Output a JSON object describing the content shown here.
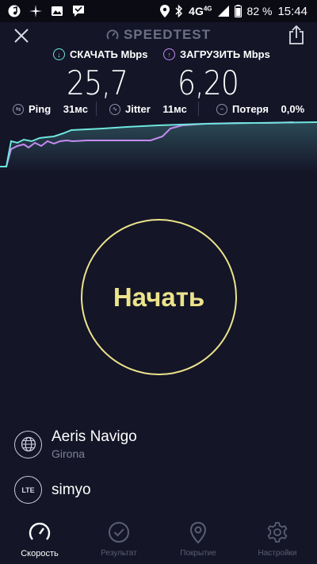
{
  "status_bar": {
    "network": "4G",
    "network_sup": "4G",
    "battery": "82 %",
    "time": "15:44",
    "left_icons": [
      "music-app-icon",
      "sparkle-app-icon",
      "gallery-app-icon",
      "messenger-app-icon"
    ],
    "right_icons": [
      "location-icon",
      "bluetooth-icon",
      "signal-icon",
      "battery-icon"
    ]
  },
  "header": {
    "title": "SPEEDTEST"
  },
  "download": {
    "label": "СКАЧАТЬ Mbps",
    "value": "25,7",
    "color": "#6fe5dd"
  },
  "upload": {
    "label": "ЗАГРУЗИТЬ Mbps",
    "value": "6,20",
    "color": "#c58cf2"
  },
  "stats": {
    "ping_label": "Ping",
    "ping_value": "31мс",
    "jitter_label": "Jitter",
    "jitter_value": "11мс",
    "loss_label": "Потеря",
    "loss_value": "0,0%"
  },
  "start_button": {
    "label": "Начать",
    "color": "#ece48c"
  },
  "provider": {
    "name": "Aeris Navigo",
    "location": "Girona"
  },
  "operator": {
    "badge": "LTE",
    "name": "simyo"
  },
  "nav": [
    {
      "label": "Скорость",
      "icon": "speedometer-icon",
      "active": true
    },
    {
      "label": "Результат",
      "icon": "check-circle-icon",
      "active": false
    },
    {
      "label": "Покрытие",
      "icon": "map-pin-icon",
      "active": false
    },
    {
      "label": "Настройки",
      "icon": "gear-icon",
      "active": false
    }
  ]
}
